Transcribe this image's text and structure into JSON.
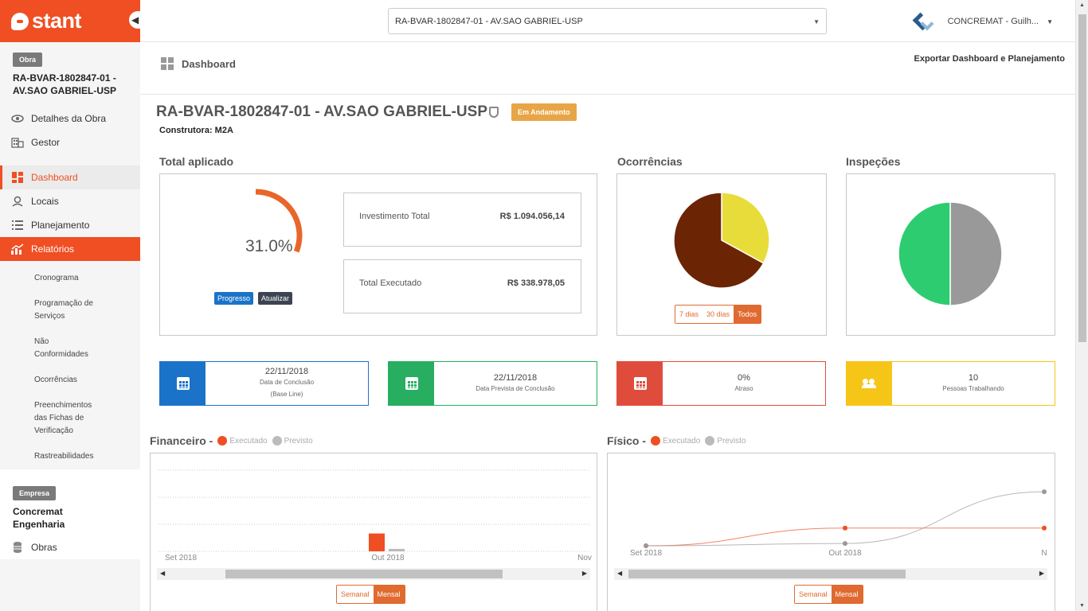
{
  "brand": {
    "name": "stant"
  },
  "sidebar": {
    "obra_badge": "Obra",
    "obra_name_line1": "RA-BVAR-1802847-01 -",
    "obra_name_line2": "AV.SAO GABRIEL-USP",
    "items_top": [
      {
        "label": "Detalhes da Obra",
        "icon": "eye-icon"
      },
      {
        "label": "Gestor",
        "icon": "building-icon"
      }
    ],
    "items_main": [
      {
        "label": "Dashboard",
        "icon": "dashboard-icon"
      },
      {
        "label": "Locais",
        "icon": "location-pin-icon"
      },
      {
        "label": "Planejamento",
        "icon": "list-icon"
      },
      {
        "label": "Relatórios",
        "icon": "chart-icon"
      }
    ],
    "sub_items": [
      "Cronograma",
      "Programação de Serviços",
      "Não Conformidades",
      "Ocorrências",
      "Preenchimentos das Fichas de Verificação",
      "Rastreabilidades"
    ],
    "empresa_badge": "Empresa",
    "empresa_name_line1": "Concremat",
    "empresa_name_line2": "Engenharia",
    "obras_label": "Obras"
  },
  "topbar": {
    "selected_obra": "RA-BVAR-1802847-01 - AV.SAO GABRIEL-USP",
    "user_name": "CONCREMAT - Guilh..."
  },
  "header": {
    "title": "Dashboard",
    "export_label": "Exportar Dashboard e Planejamento"
  },
  "project": {
    "title": "RA-BVAR-1802847-01 - AV.SAO GABRIEL-USP",
    "status": "Em Andamento",
    "constructor": "Construtora: M2A"
  },
  "total_aplicado": {
    "label": "Total aplicado",
    "percent": 31.0,
    "percent_text": "31.0%",
    "btn_progress": "Progresso",
    "btn_update": "Atualizar",
    "investimento_label": "Investimento Total",
    "investimento_value": "R$ 1.094.056,14",
    "executado_label": "Total Executado",
    "executado_value": "R$ 338.978,05",
    "accent": "#e8662a"
  },
  "ocorrencias": {
    "label": "Ocorrências",
    "periods": [
      "7 dias",
      "30 dias",
      "Todos"
    ],
    "selected_period": "Todos",
    "chart_data": {
      "type": "pie",
      "values": [
        33,
        67
      ],
      "colors": [
        "#e8dc3a",
        "#6b2505"
      ]
    }
  },
  "inspecoes": {
    "label": "Inspeções",
    "chart_data": {
      "type": "pie",
      "values": [
        50,
        50
      ],
      "colors": [
        "#999999",
        "#2ecc71"
      ]
    }
  },
  "kpis": [
    {
      "value": "22/11/2018",
      "line1": "Data de Conclusão",
      "line2": "(Base Line)",
      "color": "#1a73c9",
      "icon": "calendar-icon"
    },
    {
      "value": "22/11/2018",
      "line1": "Data Prevista de Conclusão",
      "line2": "",
      "color": "#27ae60",
      "icon": "calendar-icon"
    },
    {
      "value": "0%",
      "line1": "Atraso",
      "line2": "",
      "color": "#e04c3c",
      "icon": "calendar-icon"
    },
    {
      "value": "10",
      "line1": "Pessoas Trabalhando",
      "line2": "",
      "color": "#f5c518",
      "icon": "people-icon"
    }
  ],
  "financeiro": {
    "title": "Financeiro -",
    "legend_executado": "Executado",
    "legend_previsto": "Previsto",
    "periods": [
      "Semanal",
      "Mensal"
    ],
    "selected_period": "Mensal",
    "chart_data": {
      "type": "bar",
      "categories": [
        "Set 2018",
        "Out 2018",
        "Nov"
      ],
      "series": [
        {
          "name": "Executado",
          "color": "#f04e23",
          "values": [
            0,
            22,
            0
          ]
        },
        {
          "name": "Previsto",
          "color": "#bbbbbb",
          "values": [
            0,
            3,
            0
          ]
        }
      ],
      "ylim": [
        0,
        100
      ]
    }
  },
  "fisico": {
    "title": "Físico -",
    "legend_executado": "Executado",
    "legend_previsto": "Previsto",
    "periods": [
      "Semanal",
      "Mensal"
    ],
    "selected_period": "Mensal",
    "chart_data": {
      "type": "line",
      "categories": [
        "Set 2018",
        "Out 2018",
        "N"
      ],
      "series": [
        {
          "name": "Executado",
          "color": "#f04e23",
          "values": [
            2,
            25,
            25
          ]
        },
        {
          "name": "Previsto",
          "color": "#999999",
          "values": [
            2,
            5,
            72
          ]
        }
      ],
      "ylim": [
        0,
        100
      ]
    }
  }
}
